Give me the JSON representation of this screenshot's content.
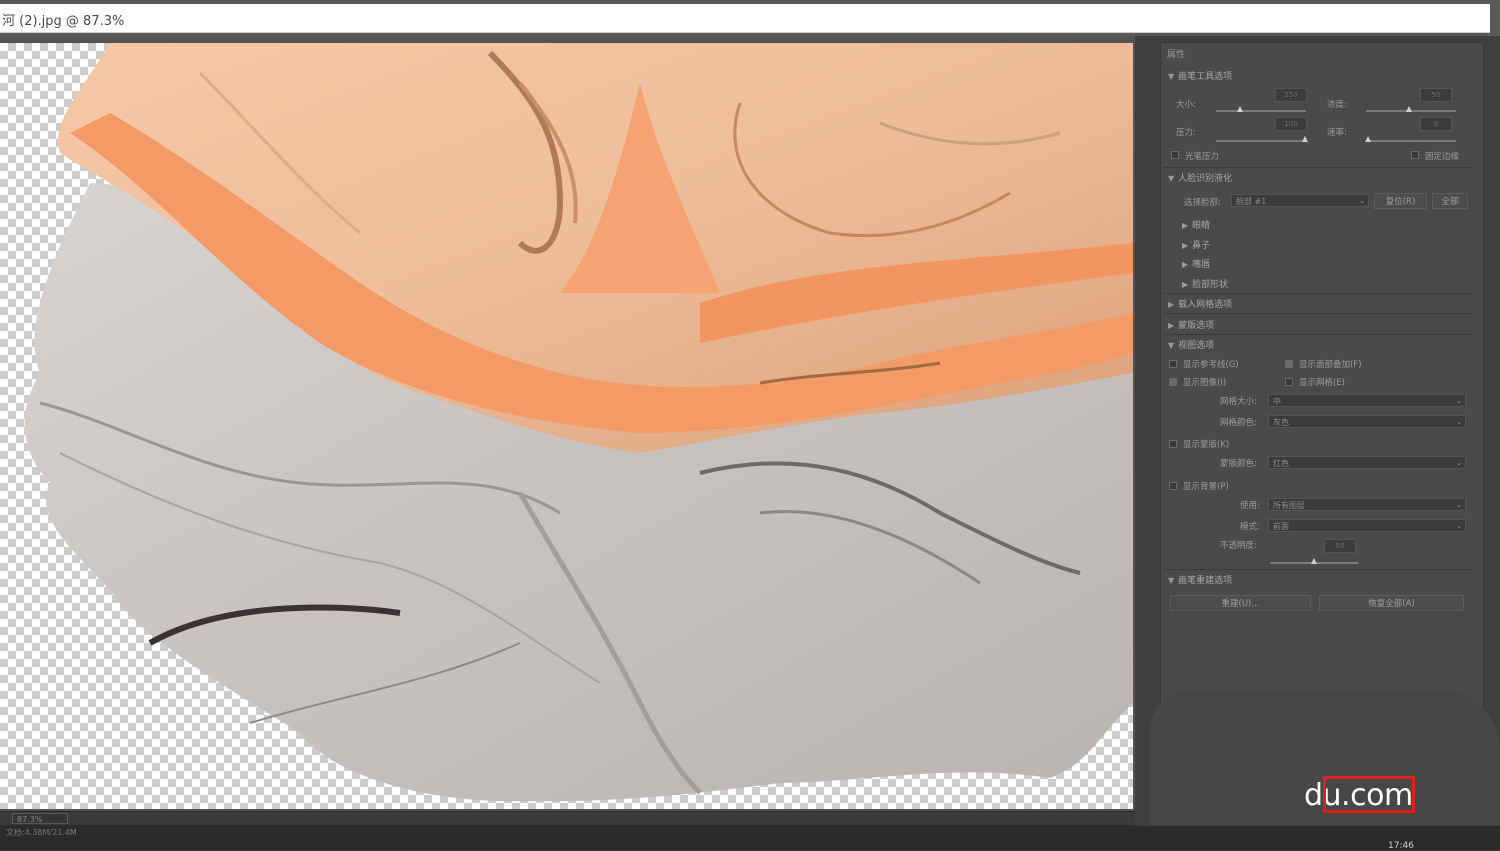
{
  "window": {
    "title": "河 (2).jpg @ 87.3%"
  },
  "status": {
    "zoom": "87.3%",
    "doc_size": "文档:4.38M/21.4M",
    "clock": "17:46"
  },
  "panel": {
    "title": "属性",
    "brush_tool": {
      "header": "画笔工具选项",
      "size_label": "大小:",
      "size_value": "250",
      "density_label": "浓度:",
      "density_value": "50",
      "pressure_label": "压力:",
      "pressure_value": "100",
      "rate_label": "速率:",
      "rate_value": "0",
      "stylus_pressure": "光笔压力",
      "pin_edges": "固定边缘"
    },
    "face_aware": {
      "header": "人脸识别液化",
      "select_face_label": "选择脸部:",
      "select_face_value": "脸部 #1",
      "reset_button": "复位(R)",
      "all_button": "全部",
      "sub_items": [
        "眼睛",
        "鼻子",
        "嘴唇",
        "脸部形状"
      ]
    },
    "load_mesh": {
      "header": "载入网格选项"
    },
    "mask": {
      "header": "蒙版选项"
    },
    "view": {
      "header": "视图选项",
      "show_guides": "显示参考线(G)",
      "show_face_overlay": "显示面部叠加(F)",
      "show_image": "显示图像(I)",
      "show_mesh": "显示网格(E)",
      "mesh_size_label": "网格大小:",
      "mesh_size_value": "中",
      "mesh_color_label": "网格颜色:",
      "mesh_color_value": "灰色",
      "show_mask": "显示蒙版(K)",
      "mask_color_label": "蒙版颜色:",
      "mask_color_value": "红色",
      "show_backdrop": "显示背景(P)",
      "use_label": "使用:",
      "use_value": "所有图层",
      "mode_label": "模式:",
      "mode_value": "前面",
      "opacity_label": "不透明度:",
      "opacity_value": "50"
    },
    "reconstruct": {
      "header": "画笔重建选项",
      "reconstruct_button": "重建(U)...",
      "restore_all_button": "恢复全部(A)"
    }
  },
  "watermark": {
    "text": "du.com"
  },
  "colors": {
    "panel_bg": "#4a4a4a",
    "accent_red": "#e0201c"
  }
}
